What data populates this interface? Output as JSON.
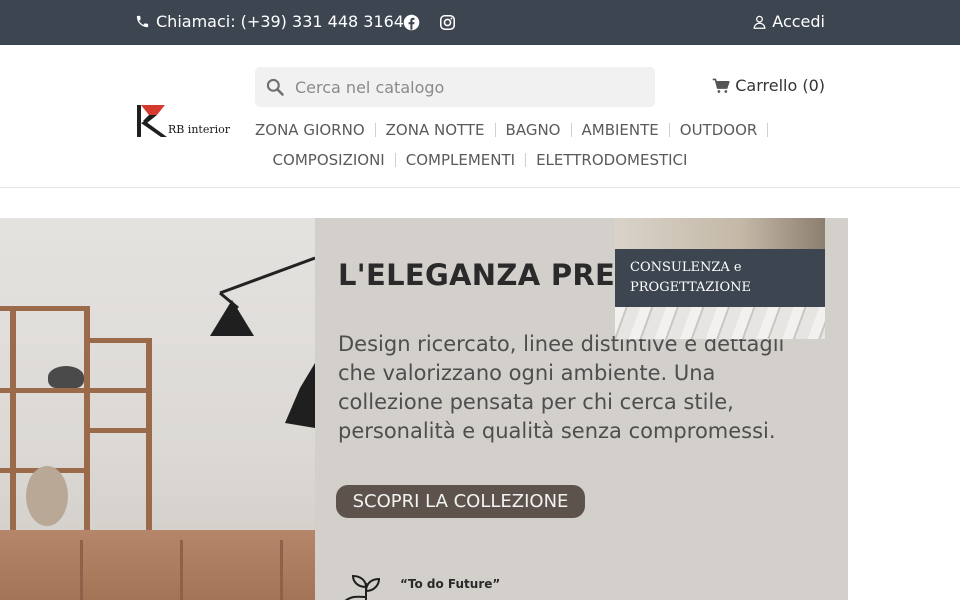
{
  "topbar": {
    "phone_label": "Chiamaci: (+39) 331 448 3164",
    "login_label": "Accedi",
    "colors": {
      "background": "#3c4550",
      "text": "#ffffff"
    },
    "icons": [
      "phone-icon",
      "facebook-icon",
      "instagram-icon",
      "user-icon"
    ]
  },
  "header": {
    "logo_text": "RB interior",
    "search": {
      "placeholder": "Cerca nel catalogo",
      "value": ""
    },
    "cart_label": "Carrello (0)",
    "nav_rows": [
      [
        "ZONA GIORNO",
        "ZONA NOTTE",
        "BAGNO",
        "AMBIENTE",
        "OUTDOOR"
      ],
      [
        "COMPOSIZIONI",
        "COMPLEMENTI",
        "ELETTRODOMESTICI"
      ]
    ]
  },
  "banner": {
    "headline": "L'ELEGANZA PREI",
    "description": "Design ricercato, linee distintive e dettagli che valorizzano ogni ambiente. Una collezione pensata per chi cerca stile, personalità e qualità senza compromessi.",
    "cta_label": "SCOPRI LA COLLEZIONE",
    "future_title": "“To do Future”"
  },
  "consult_card": {
    "line1": "CONSULENZA e",
    "line2": "PROGETTAZIONE"
  },
  "colors": {
    "accent_dark": "#3d4650",
    "cta_background": "#5d534c",
    "logo_red": "#d63a2f"
  }
}
